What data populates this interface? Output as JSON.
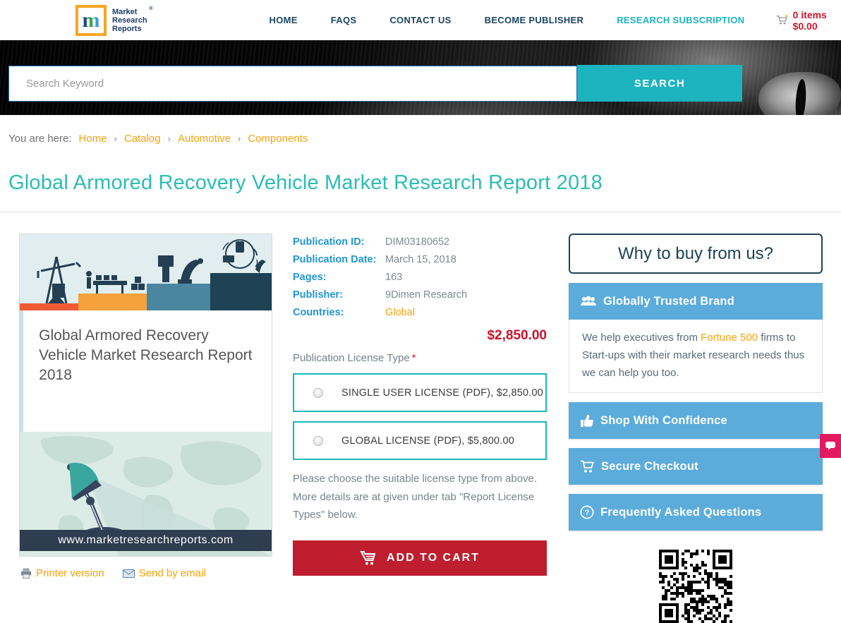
{
  "header": {
    "logo": {
      "monogram": "m",
      "line1": "Market",
      "line2": "Research",
      "line3": "Reports",
      "registered": "®"
    },
    "nav": [
      {
        "label": "HOME"
      },
      {
        "label": "FAQS"
      },
      {
        "label": "CONTACT US"
      },
      {
        "label": "BECOME PUBLISHER"
      },
      {
        "label": "RESEARCH SUBSCRIPTION"
      }
    ],
    "cart_summary": "0 items $0.00"
  },
  "banner": {
    "search_placeholder": "Search Keyword",
    "search_button": "SEARCH"
  },
  "breadcrumb": {
    "prefix": "You are here:",
    "separator": "›",
    "items": [
      "Home",
      "Catalog",
      "Automotive",
      "Components"
    ]
  },
  "page": {
    "title": "Global Armored Recovery Vehicle Market Research Report 2018"
  },
  "product": {
    "cover_title": "Global Armored Recovery Vehicle Market Research Report 2018",
    "cover_website": "www.marketresearchreports.com",
    "printer_link": "Printer version",
    "email_link": "Send by email"
  },
  "details": {
    "rows": [
      {
        "label": "Publication ID:",
        "value": "DIM03180652"
      },
      {
        "label": "Publication Date:",
        "value": "March 15, 2018"
      },
      {
        "label": "Pages:",
        "value": "163"
      },
      {
        "label": "Publisher:",
        "value": "9Dimen Research"
      },
      {
        "label": "Countries:",
        "value": "Global"
      }
    ],
    "price": "$2,850.00",
    "license_label": "Publication License Type",
    "required_mark": "*",
    "license_options": [
      {
        "label": "SINGLE USER LICENSE (PDF), $2,850.00"
      },
      {
        "label": "GLOBAL LICENSE (PDF), $5,800.00"
      }
    ],
    "note": "Please choose the suitable license type from above. More details are at given under tab \"Report License Types\" below.",
    "add_to_cart": "ADD TO CART"
  },
  "sidebar": {
    "why_title": "Why to buy from us?",
    "features": [
      {
        "title": "Globally Trusted Brand",
        "icon": "users-icon",
        "body_before": "We help executives from ",
        "body_link": "Fortune 500",
        "body_after": " firms to Start-ups with their market research needs thus we can help you too."
      },
      {
        "title": "Shop With Confidence",
        "icon": "thumbs-up-icon"
      },
      {
        "title": "Secure Checkout",
        "icon": "cart-icon"
      },
      {
        "title": "Frequently Asked Questions",
        "icon": "question-icon"
      }
    ]
  },
  "colors": {
    "accent_teal": "#1cb4be",
    "title_teal": "#2abdb4",
    "navy": "#1d4354",
    "label_blue": "#2196d3",
    "link_orange": "#f7a30b",
    "price_red": "#c9122c",
    "button_red": "#be1e2d",
    "feature_blue": "#5bacdb",
    "chat_pink": "#e5195f"
  }
}
